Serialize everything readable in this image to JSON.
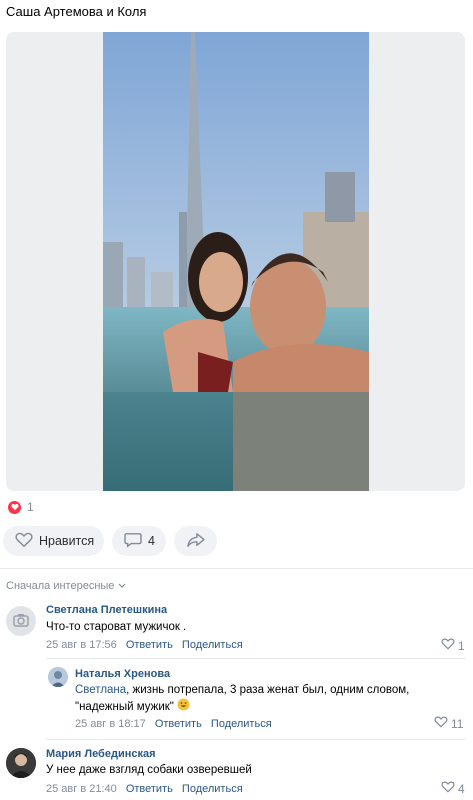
{
  "post": {
    "caption": "Саша Артемова и Коля",
    "likes_count": "1",
    "like_label": "Нравится",
    "comments_count": "4"
  },
  "comments_sort": "Сначала интересные",
  "comments": [
    {
      "author": "Светлана Плетешкина",
      "text": "Что-то староват мужичок .",
      "date": "25 авг в 17:56",
      "reply": "Ответить",
      "share": "Поделиться",
      "likes": "1"
    },
    {
      "author": "Наталья Хренова",
      "mention": "Светлана",
      "text_line1": ", жизнь потрепала, 3 раза женат был, одним словом,",
      "text_line2": "\"надежный мужик\"",
      "date": "25 авг в 18:17",
      "reply": "Ответить",
      "share": "Поделиться",
      "likes": "11"
    },
    {
      "author": "Мария Лебединская",
      "text": "У нее даже взгляд собаки озверевшей",
      "date": "25 авг в 21:40",
      "reply": "Ответить",
      "share": "Поделиться",
      "likes": "4"
    }
  ],
  "colors": {
    "link": "#2a5885",
    "muted": "#818c99",
    "heart": "#ff3347",
    "pill_bg": "#f0f2f5"
  },
  "icons": [
    "heart-icon",
    "comment-icon",
    "share-icon",
    "camera-icon",
    "chevron-down-icon"
  ]
}
